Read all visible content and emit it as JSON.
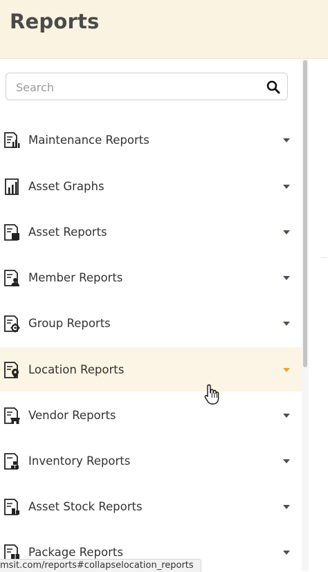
{
  "header": {
    "title": "Reports"
  },
  "search": {
    "placeholder": "Search"
  },
  "menu": [
    {
      "label": "Maintenance Reports",
      "icon": "maintenance-report-icon"
    },
    {
      "label": "Asset Graphs",
      "icon": "asset-graph-icon"
    },
    {
      "label": "Asset Reports",
      "icon": "asset-report-icon"
    },
    {
      "label": "Member Reports",
      "icon": "member-report-icon"
    },
    {
      "label": "Group Reports",
      "icon": "group-report-icon"
    },
    {
      "label": "Location Reports",
      "icon": "location-report-icon",
      "active": true
    },
    {
      "label": "Vendor Reports",
      "icon": "vendor-report-icon"
    },
    {
      "label": "Inventory Reports",
      "icon": "inventory-report-icon"
    },
    {
      "label": "Asset Stock Reports",
      "icon": "asset-stock-report-icon"
    },
    {
      "label": "Package Reports",
      "icon": "package-report-icon"
    }
  ],
  "status_bar": {
    "url": "msit.com/reports#collapselocation_reports"
  },
  "colors": {
    "header_bg": "#fbf3e2",
    "active_row_bg": "#fcf4e4",
    "accent": "#e8a23a"
  }
}
